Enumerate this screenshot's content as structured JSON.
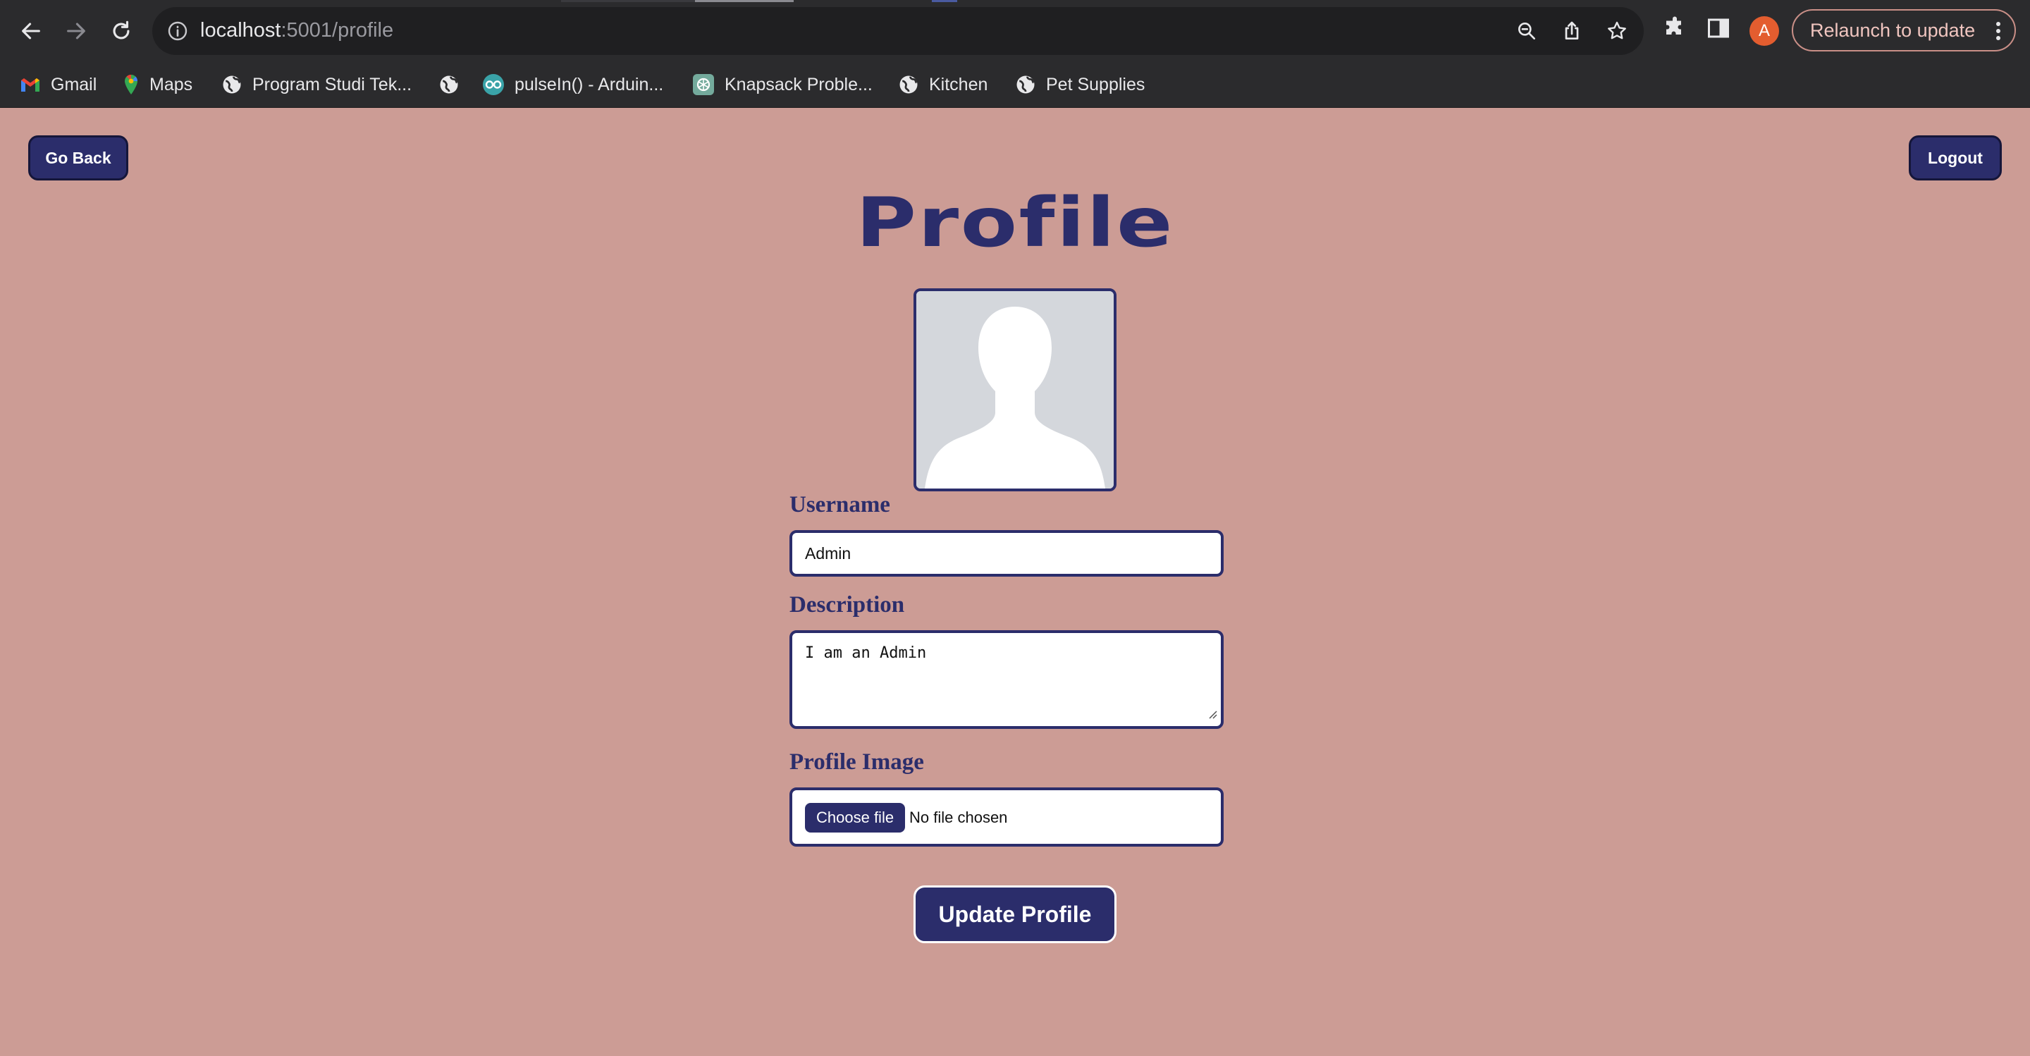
{
  "browser": {
    "url_host": "localhost",
    "url_path": ":5001/profile",
    "avatar_initial": "A",
    "relaunch_label": "Relaunch to update",
    "bookmarks": [
      {
        "label": "Gmail",
        "icon": "gmail-icon"
      },
      {
        "label": "Maps",
        "icon": "maps-pin-icon"
      },
      {
        "label": "Program Studi Tek...",
        "icon": "globe-icon"
      },
      {
        "label": "",
        "icon": "globe-icon"
      },
      {
        "label": "pulseIn() - Arduin...",
        "icon": "arduino-icon"
      },
      {
        "label": "Knapsack Proble...",
        "icon": "openai-icon"
      },
      {
        "label": "Kitchen",
        "icon": "globe-icon"
      },
      {
        "label": "Pet Supplies",
        "icon": "globe-icon"
      }
    ]
  },
  "page": {
    "go_back_label": "Go Back",
    "logout_label": "Logout",
    "title": "Profile",
    "avatar_icon": "default-user-silhouette",
    "username_label": "Username",
    "username_value": "Admin",
    "description_label": "Description",
    "description_value": "I am an Admin",
    "profile_image_label": "Profile Image",
    "choose_file_label": "Choose file",
    "no_file_text": "No file chosen",
    "update_button_label": "Update Profile"
  },
  "colors": {
    "page_background": "#cc9c95",
    "primary": "#2b2d6b",
    "chrome": "#2b2b2d",
    "profile_badge": "#e35d2f"
  }
}
